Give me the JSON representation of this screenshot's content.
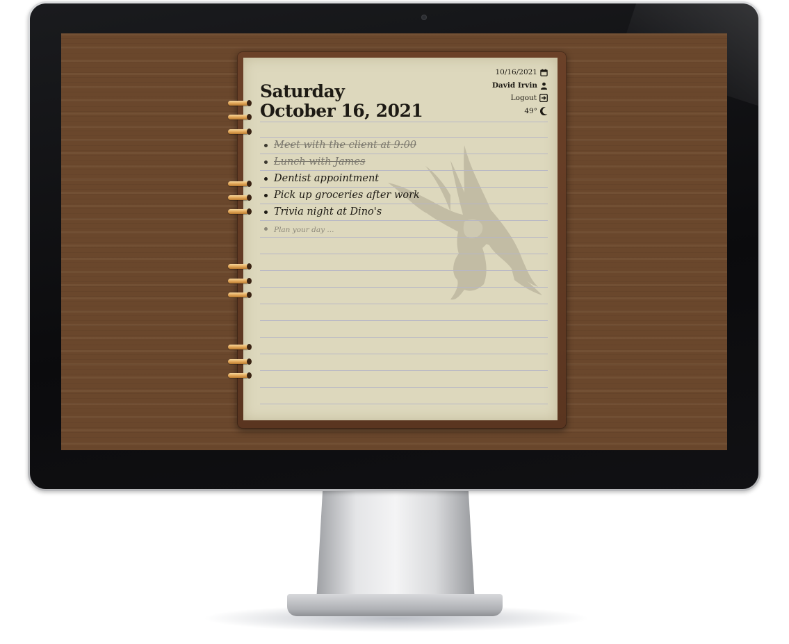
{
  "planner": {
    "day_name": "Saturday",
    "full_date": "October 16, 2021",
    "short_date": "10/16/2021",
    "user_name": "David Irvin",
    "logout_label": "Logout",
    "temperature": "49°",
    "todos": [
      {
        "text": "Meet with the client at 9:00",
        "done": true
      },
      {
        "text": "Lunch with James",
        "done": true
      },
      {
        "text": "Dentist appointment",
        "done": false
      },
      {
        "text": "Pick up groceries after work",
        "done": false
      },
      {
        "text": "Trivia night at Dino's",
        "done": false
      }
    ],
    "new_todo_placeholder": "Plan your day ..."
  },
  "icons": {
    "calendar": "calendar-icon",
    "user": "user-icon",
    "logout": "logout-icon",
    "weather": "moon-icon"
  },
  "colors": {
    "desk_wood": "#6e4a2e",
    "cover_leather": "#5a3520",
    "paper": "#ddd8bd",
    "ring_gold": "#e3a85a"
  }
}
